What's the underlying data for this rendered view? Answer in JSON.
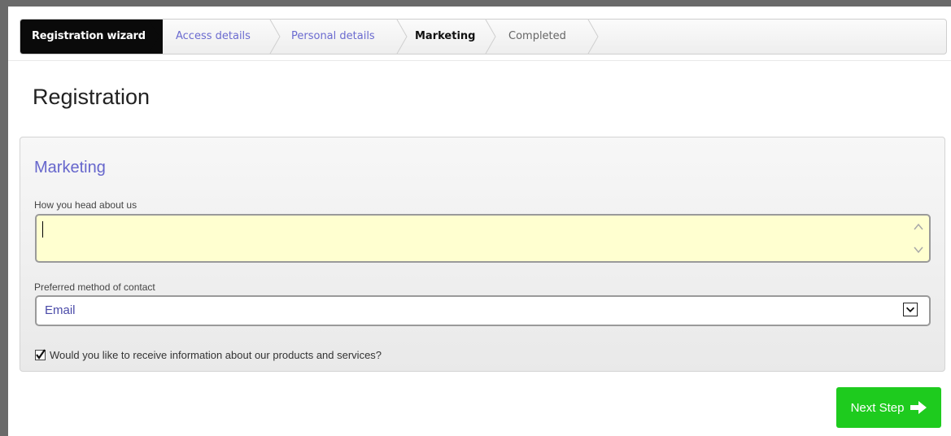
{
  "wizard": {
    "title": "Registration wizard",
    "steps": [
      {
        "label": "Access details",
        "state": "done"
      },
      {
        "label": "Personal details",
        "state": "done"
      },
      {
        "label": "Marketing",
        "state": "active"
      },
      {
        "label": "Completed",
        "state": "future"
      }
    ]
  },
  "page": {
    "title": "Registration"
  },
  "marketing": {
    "heading": "Marketing",
    "heard_label": "How you head about us",
    "heard_value": "",
    "contact_label": "Preferred method of contact",
    "contact_value": "Email",
    "consent_label": "Would you like to receive information about our products and services?",
    "consent_checked": true
  },
  "actions": {
    "next_label": "Next Step"
  },
  "colors": {
    "accent": "#6666cc",
    "next_button": "#1ecb1e",
    "textarea_bg": "#ffffd0",
    "wizard_title_bg": "#0a0a0a"
  },
  "icons": [
    "chevron-right-separator",
    "scroll-up-icon",
    "scroll-down-icon",
    "dropdown-icon",
    "checkmark-icon",
    "arrow-right-icon"
  ]
}
